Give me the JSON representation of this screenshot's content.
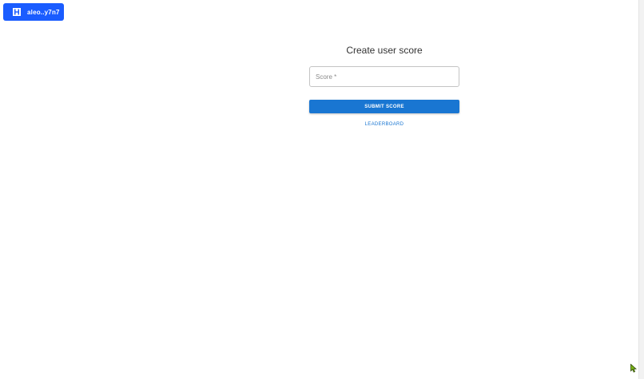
{
  "wallet": {
    "label": "aleo..y7n7",
    "icon": "wallet-logo-icon",
    "color": "#1a5cff"
  },
  "form": {
    "title": "Create user score",
    "score_placeholder": "Score *",
    "score_value": "",
    "submit_label": "SUBMIT SCORE",
    "leaderboard_label": "LEADERBOARD",
    "accent_color": "#1976d2"
  },
  "cursor": {
    "icon": "mouse-pointer-icon"
  }
}
